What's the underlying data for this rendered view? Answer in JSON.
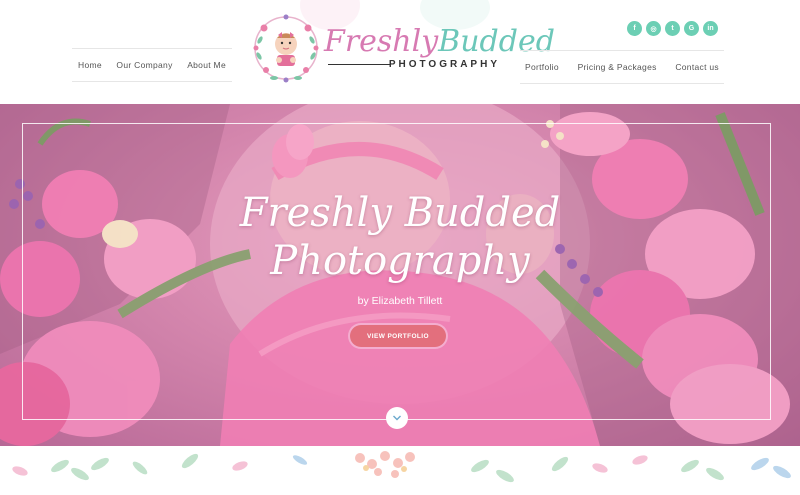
{
  "brand": {
    "title_word1": "Freshly",
    "title_word2": "Budded",
    "subtitle": "PHOTOGRAPHY"
  },
  "nav": {
    "left": [
      "Home",
      "Our Company",
      "About Me"
    ],
    "right": [
      "Portfolio",
      "Pricing & Packages",
      "Contact us"
    ]
  },
  "social": [
    {
      "icon": "facebook-icon",
      "glyph": "f"
    },
    {
      "icon": "instagram-icon",
      "glyph": "◎"
    },
    {
      "icon": "twitter-icon",
      "glyph": "t"
    },
    {
      "icon": "google-plus-icon",
      "glyph": "G"
    },
    {
      "icon": "linkedin-icon",
      "glyph": "in"
    }
  ],
  "hero": {
    "title_line1": "Freshly Budded",
    "title_line2": "Photography",
    "byline": "by Elizabeth Tillett",
    "button_label": "VIEW PORTFOLIO"
  },
  "colors": {
    "accent_pink": "#d77ab2",
    "accent_teal": "#6cc7b9",
    "button": "#e36f7d",
    "social": "#6ccfb4"
  }
}
